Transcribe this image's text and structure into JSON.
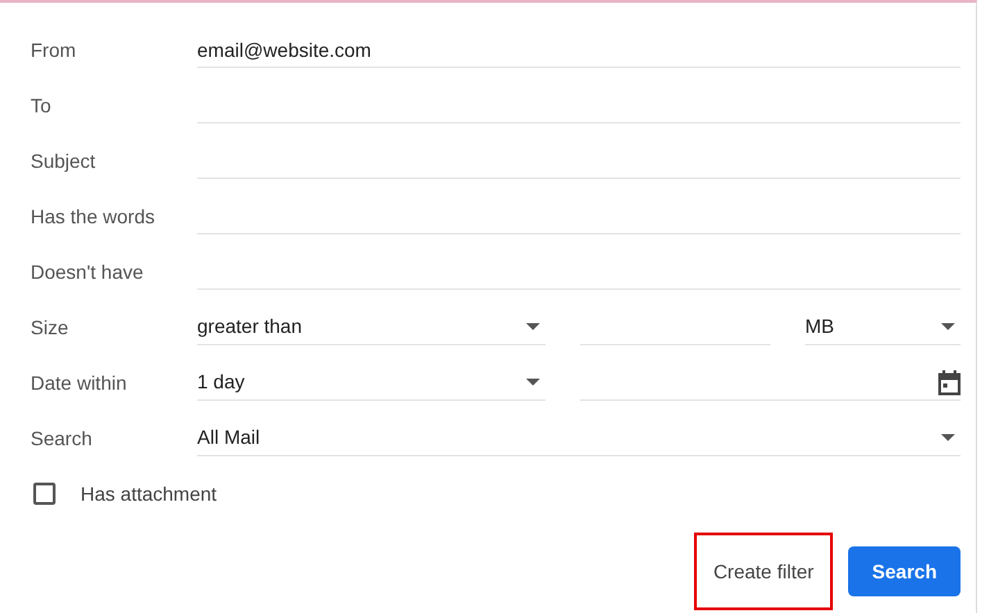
{
  "fields": [
    {
      "kind": "text",
      "label": "From",
      "value": "email@website.com"
    },
    {
      "kind": "text",
      "label": "To"
    },
    {
      "kind": "text",
      "label": "Subject"
    },
    {
      "kind": "text",
      "label": "Has the words"
    },
    {
      "kind": "text",
      "label": "Doesn't have"
    },
    {
      "kind": "size",
      "label": "Size",
      "operator": "greater than",
      "unit": "MB"
    },
    {
      "kind": "date",
      "label": "Date within",
      "range": "1 day"
    },
    {
      "kind": "select",
      "label": "Search",
      "value": "All Mail"
    }
  ],
  "checkbox": {
    "label": "Has attachment",
    "checked": false
  },
  "buttons": [
    {
      "kind": "text",
      "label": "Create filter",
      "highlighted": true
    },
    {
      "kind": "primary",
      "label": "Search",
      "highlighted": false
    }
  ]
}
